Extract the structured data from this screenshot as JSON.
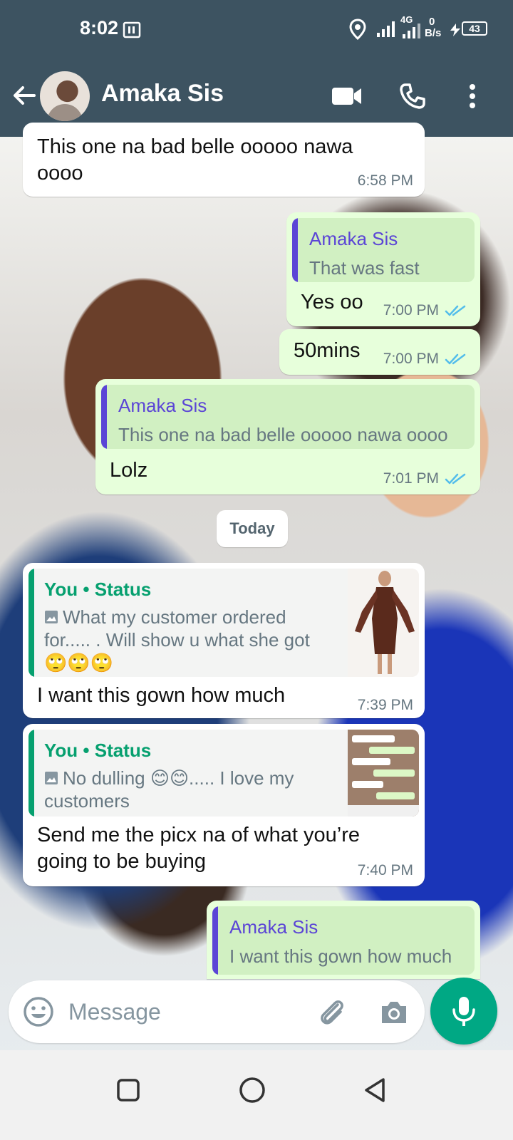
{
  "status_bar": {
    "time": "8:02",
    "network": "4G",
    "speed_value": "0",
    "speed_unit": "B/s",
    "battery": "43"
  },
  "header": {
    "contact_name": "Amaka Sis"
  },
  "date_divider": "Today",
  "messages": [
    {
      "direction": "in",
      "text_line1": "This one na bad belle ooooo nawa",
      "text_line2": "oooo",
      "time": "6:58 PM"
    },
    {
      "direction": "out",
      "quote_name": "Amaka Sis",
      "quote_text": "That was fast",
      "text": "Yes oo",
      "time": "7:00 PM"
    },
    {
      "direction": "out",
      "text": "50mins",
      "time": "7:00 PM"
    },
    {
      "direction": "out",
      "quote_name": "Amaka Sis",
      "quote_text": "This one na bad belle ooooo nawa oooo",
      "text": "Lolz",
      "time": "7:01 PM"
    },
    {
      "direction": "in",
      "quote_name": "You • Status",
      "quote_line1": "What my customer ordered",
      "quote_line2": "for..... . Will show u what she got",
      "quote_line3": "🙄🙄🙄",
      "text": "I want this gown how much",
      "time": "7:39 PM"
    },
    {
      "direction": "in",
      "quote_name": "You • Status",
      "quote_line1": "No dulling 😊😊..... I love my",
      "quote_line2": "customers",
      "text_line1": "Send me the picx na of what you’re",
      "text_line2": "going to be buying",
      "time": "7:40 PM"
    },
    {
      "direction": "out",
      "quote_name": "Amaka Sis",
      "quote_text": "I want this gown how much"
    }
  ],
  "composer": {
    "placeholder": "Message"
  },
  "colors": {
    "header_bg": "#3d5361",
    "outgoing_bubble": "#e7ffdb",
    "incoming_bubble": "#ffffff",
    "accent_green": "#00a884",
    "quote_purple": "#5b45d6",
    "tick_blue": "#53bdeb"
  },
  "icons": [
    "back-arrow-icon",
    "video-call-icon",
    "phone-icon",
    "more-vert-icon",
    "emoji-icon",
    "attach-icon",
    "camera-icon",
    "mic-icon",
    "image-icon",
    "read-ticks-icon",
    "location-icon",
    "signal-icon",
    "battery-icon"
  ]
}
